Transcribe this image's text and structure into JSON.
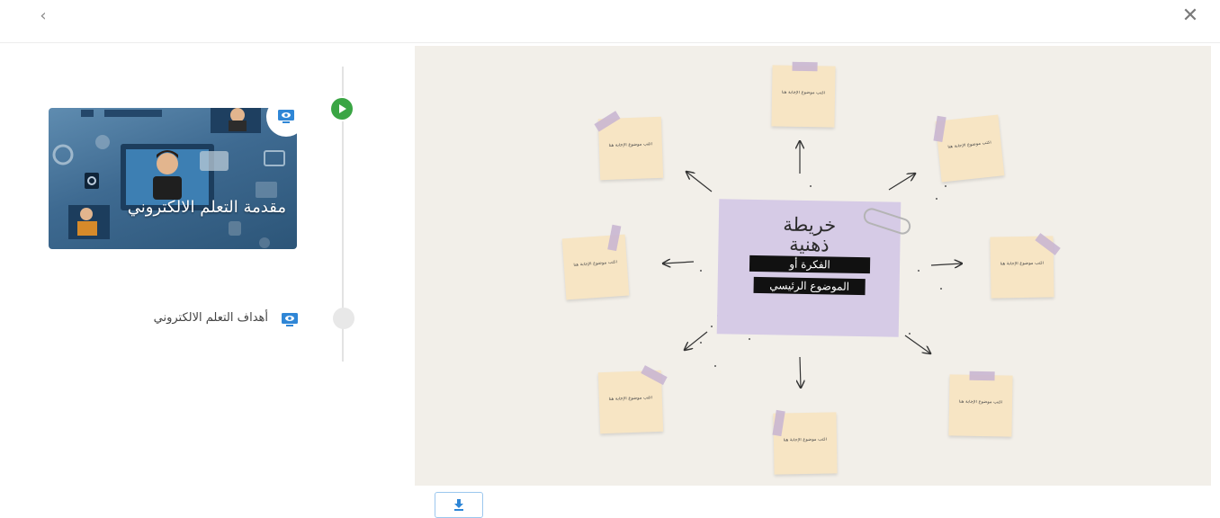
{
  "nav": {
    "back_glyph": "‹",
    "close_glyph": "✕"
  },
  "lessons": [
    {
      "title": "مقدمة التعلم الالكتروني",
      "state": "active",
      "icon": "monitor-icon"
    },
    {
      "title": "أهداف التعلم الالكتروني",
      "state": "inactive",
      "icon": "monitor-icon"
    }
  ],
  "slide": {
    "center": {
      "title_line1": "خريطة",
      "title_line2": "ذهنية",
      "bar1": "الفكرة أو",
      "bar2": "الموضوع الرئيسي"
    },
    "note_text": "اكتب موضوع الإجابة هنا"
  },
  "download": {
    "icon": "download-icon"
  },
  "colors": {
    "accent_green": "#3aa544",
    "accent_blue": "#2f86d6",
    "note": "#f7e5c4",
    "center_note": "#d6cbe6"
  }
}
